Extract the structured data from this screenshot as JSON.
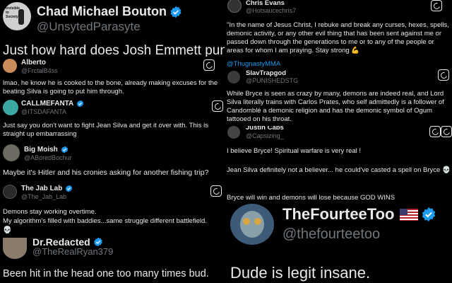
{
  "colors": {
    "verified": "#1d9bf0",
    "text": "#e7e9ea",
    "muted": "#71767b",
    "bg": "#000000"
  },
  "top_left": {
    "name": "Chad Michael Bouton",
    "handle": "@UnsytedParasyte",
    "text": "Just how hard does Josh Emmett punch?",
    "avatar_text": "Invisible to Society"
  },
  "alberto": {
    "name": "Alberto",
    "handle": "@FrctalB4ss",
    "text": "lmao, he know he is cooked to the bone, already making excuses for the beating Silva is going to put him through."
  },
  "callme": {
    "name": "CALLMEFANTA",
    "handle": "@ITSDAFANTA",
    "text": "Just say you don't want to fight Jean Silva and get it over with. This is straight up embarrassing"
  },
  "moish": {
    "name": "Big Moish",
    "handle": "@ABoredBochur",
    "text": "Maybe it's Hitler and his cronies asking for another fishing trip?"
  },
  "jablab": {
    "name": "The Jab Lab",
    "handle": "@The_Jab_Lab",
    "line1": "Demons stay working overtime.",
    "line2": "My algorithm's filled with baddies...same struggle different battlefield.",
    "emoji": "💀"
  },
  "redacted": {
    "name": "Dr.Redacted",
    "handle": "@TheRealRyan379",
    "text": "Been hit in the head one too many times bud."
  },
  "chris": {
    "name": "Chris Evans",
    "handle": "@Hotsaucechris7",
    "text": "\"In the name of Jesus Christ, I rebuke and break any curses, hexes, spells, demonic activity, or any other evil thing that has been sent against me or passed down through the generations to me or to any of the people or areas for whom I am praying. Stay strong",
    "emoji": "💪",
    "mention": "@ThugnastyMMA"
  },
  "slav": {
    "name": "SlavTrapgod",
    "handle": "@PUNISHEDSTG",
    "text": "While Bryce is seen as crazy by many, demons are indeed real, and Lord Silva literally trains with Carlos Prates, who self admittedly is a follower of Candomblé a demonic religion and has the demonic symbol of Ogum tattooed on his throat."
  },
  "justin": {
    "name": "Justin Cabs",
    "handle": "@Capsizing_",
    "line1": "I believe Bryce! Spiritual warfare is very real !",
    "line2": "Jean Silva definitely not a believer... he could've casted a spell on Bryce",
    "line3": "Bryce will win and demons will lose because GOD WINS",
    "emoji": "💀"
  },
  "fourtee": {
    "name": "TheFourteeToo",
    "handle": "@thefourteetoo",
    "text": "Dude is legit insane."
  }
}
